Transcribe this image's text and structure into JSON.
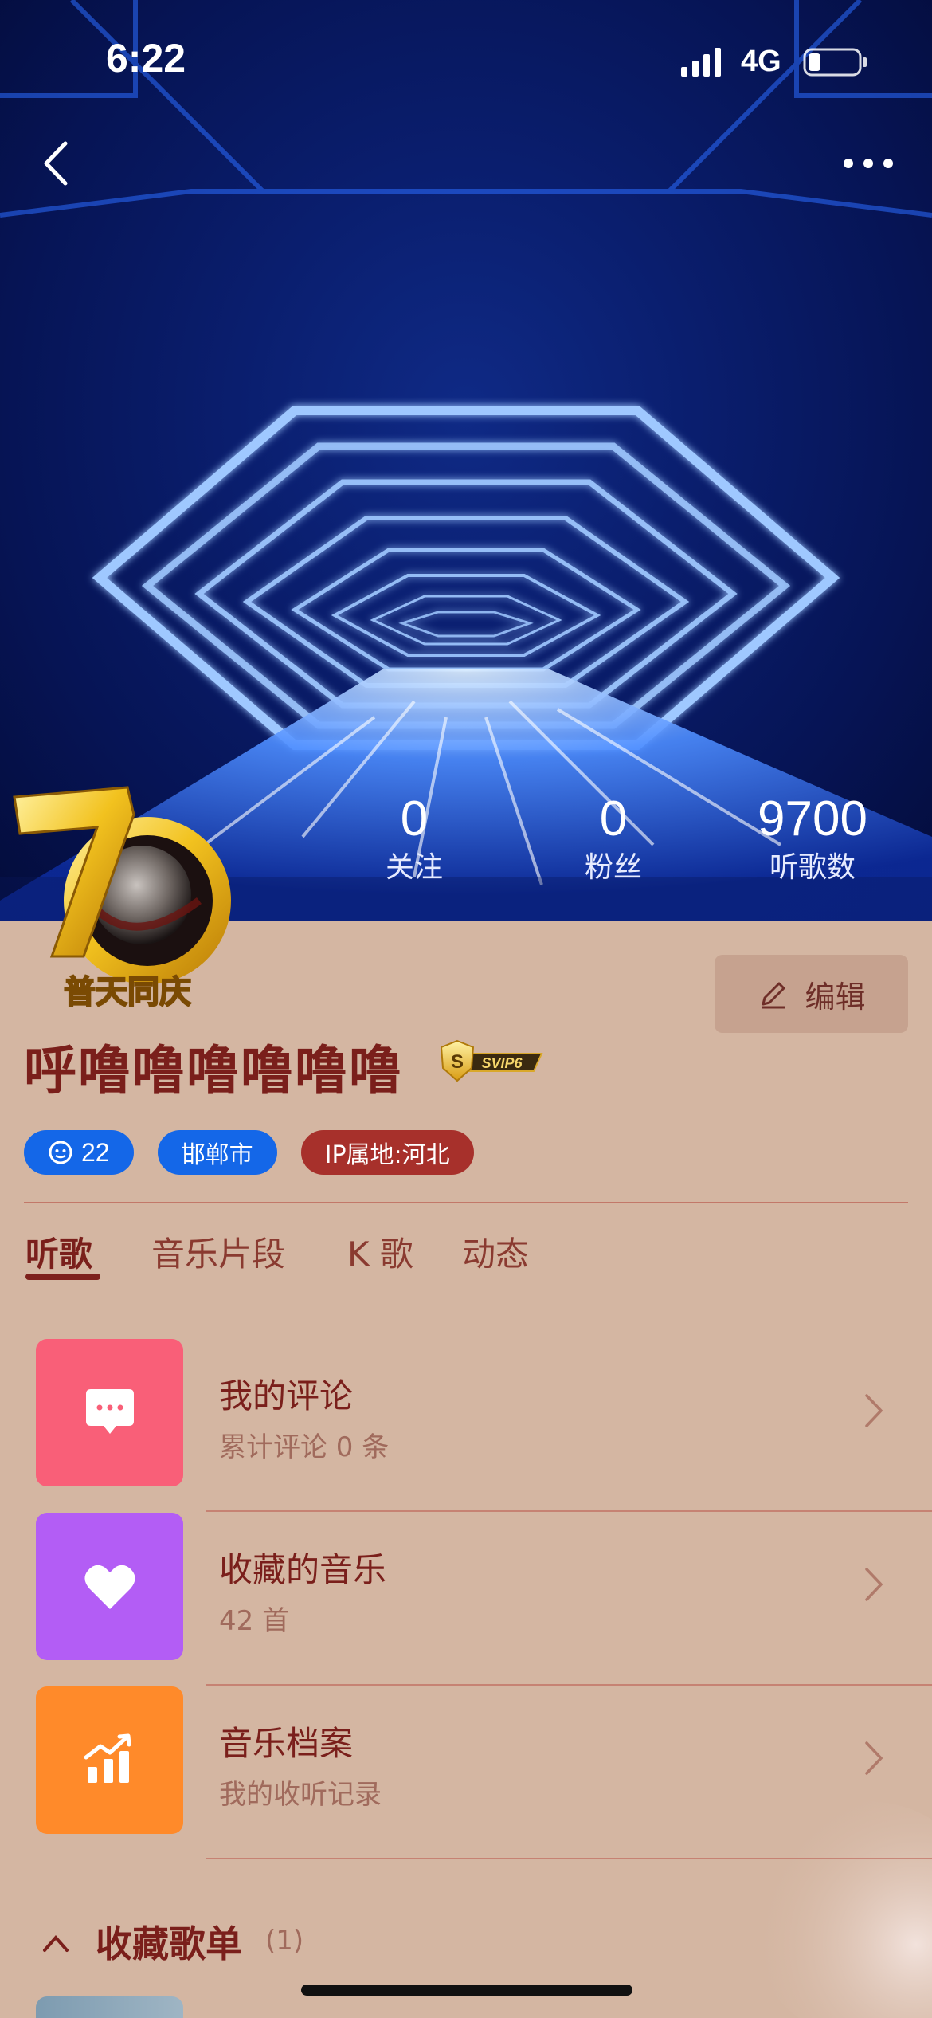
{
  "status_bar": {
    "time": "6:22",
    "network": "4G",
    "battery_level": 0.25
  },
  "header": {
    "back_icon": "chevron-left-icon",
    "more_icon": "more-dots-icon"
  },
  "stats": [
    {
      "value": "0",
      "label": "关注"
    },
    {
      "value": "0",
      "label": "粉丝"
    },
    {
      "value": "9700",
      "label": "听歌数"
    }
  ],
  "badge": {
    "caption": "普天同庆",
    "number": "70"
  },
  "profile": {
    "nickname": "呼噜噜噜噜噜噜",
    "vip_label": "SVIP6",
    "vip_letter": "S",
    "edit_label": "编辑",
    "tags": {
      "age": "22",
      "city": "邯郸市",
      "ip": "IP属地:河北"
    }
  },
  "tabs": [
    "听歌",
    "音乐片段",
    "K 歌",
    "动态"
  ],
  "active_tab": 0,
  "list": [
    {
      "title": "我的评论",
      "subtitle": "累计评论 0 条",
      "icon": "comment-icon",
      "color": "#f95f78"
    },
    {
      "title": "收藏的音乐",
      "subtitle": "42 首",
      "icon": "heart-icon",
      "color": "#b35df5"
    },
    {
      "title": "音乐档案",
      "subtitle": "我的收听记录",
      "icon": "chart-up-icon",
      "color": "#ff8a2a"
    }
  ],
  "collected_playlists": {
    "title": "收藏歌单",
    "count": "(1)"
  }
}
